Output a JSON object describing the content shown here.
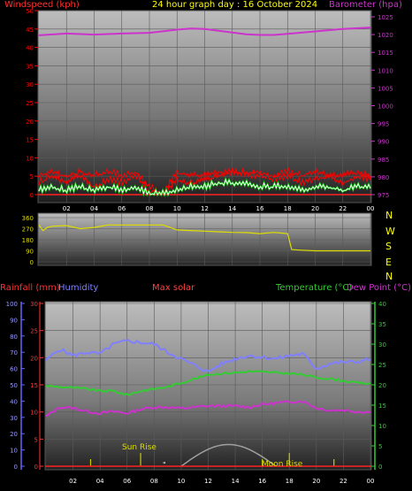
{
  "header": {
    "wind_label": "Windspeed (kph)",
    "title": "24 hour graph day : 16 October 2024",
    "baro_label": "Barometer (hpa)"
  },
  "bottom_header": {
    "rain_label": "Rainfall (mm)",
    "humidity_label": "Humidity",
    "solar_label": "Max solar",
    "temp_label": "Temperature (°C)",
    "dew_label": "Dew Point (°C)"
  },
  "annotations": {
    "sunrise": "Sun Rise",
    "moonrise": "Moon Rise",
    "dot": "\""
  },
  "compass": [
    "N",
    "W",
    "S",
    "E",
    "N"
  ],
  "colors": {
    "wind": "#ff0000",
    "gust": "#ff0000",
    "avg_wind": "#ffffff",
    "avg_wind_glow": "#00cc00",
    "barometer": "#cc33cc",
    "direction": "#dddd00",
    "humidity": "#8080ff",
    "temperature": "#33cc33",
    "dewpoint": "#cc33cc",
    "solar": "#a0a0a0",
    "rain_axis": "#ff3333",
    "hum_axis": "#6666ff",
    "temp_axis": "#33cc33",
    "title": "#ffff00",
    "events": "#cccc00"
  },
  "chart_data": [
    {
      "type": "line",
      "title": "24 hour graph day : 16 October 2024",
      "x_ticks": [
        "02",
        "04",
        "06",
        "08",
        "10",
        "12",
        "14",
        "16",
        "18",
        "20",
        "22",
        "00"
      ],
      "left_axis": {
        "label": "Windspeed (kph)",
        "ylim": [
          0,
          50
        ],
        "ticks": [
          0,
          5,
          10,
          15,
          20,
          25,
          30,
          35,
          40,
          45,
          50
        ]
      },
      "right_axis": {
        "label": "Barometer (hpa)",
        "ylim": [
          972.5,
          1027.5
        ],
        "ticks": [
          975,
          980,
          985,
          990,
          995,
          1000,
          1005,
          1010,
          1015,
          1020,
          1025
        ]
      },
      "series": [
        {
          "name": "Barometer (hpa)",
          "axis": "right",
          "x": [
            0,
            2,
            4,
            6,
            8,
            10,
            11,
            12,
            13,
            14,
            15,
            16,
            17,
            18,
            20,
            22,
            24
          ],
          "values": [
            1019.8,
            1020.3,
            1020.0,
            1020.3,
            1020.5,
            1021.4,
            1021.7,
            1021.6,
            1021.1,
            1020.6,
            1020.1,
            1019.9,
            1019.9,
            1020.2,
            1020.9,
            1021.6,
            1022.0
          ]
        },
        {
          "name": "Windspeed (kph)",
          "axis": "left",
          "x": [
            0,
            1,
            2,
            3,
            4,
            5,
            6,
            7,
            8,
            9,
            10,
            11,
            12,
            13,
            14,
            15,
            16,
            17,
            18,
            19,
            20,
            21,
            22,
            23,
            24
          ],
          "values": [
            3,
            5,
            3,
            5,
            2,
            4,
            3,
            5,
            1,
            0,
            4,
            3,
            4,
            5,
            6,
            5,
            5,
            4,
            5,
            3,
            4,
            5,
            3,
            5,
            4
          ]
        },
        {
          "name": "Gust (kph)",
          "axis": "left",
          "x": [
            0,
            1,
            2,
            3,
            4,
            5,
            6,
            7,
            8,
            9,
            10,
            11,
            12,
            13,
            14,
            15,
            16,
            17,
            18,
            19,
            20,
            21,
            22,
            23,
            24
          ],
          "values": [
            5,
            6,
            5,
            6,
            5,
            6,
            5,
            6,
            2,
            0,
            6,
            5,
            5,
            6,
            6,
            6,
            6,
            5,
            6,
            5,
            6,
            5,
            5,
            6,
            5
          ]
        },
        {
          "name": "Average wind (kph)",
          "axis": "left",
          "x": [
            0,
            1,
            2,
            3,
            4,
            5,
            6,
            7,
            8,
            9,
            10,
            11,
            12,
            13,
            14,
            15,
            16,
            17,
            18,
            19,
            20,
            21,
            22,
            23,
            24
          ],
          "values": [
            1,
            2,
            1,
            2,
            1,
            2,
            1,
            2,
            0,
            0,
            1,
            2,
            2,
            3,
            3,
            3,
            2,
            2,
            2,
            1,
            2,
            2,
            1,
            2,
            2
          ]
        }
      ]
    },
    {
      "type": "line",
      "x_ticks": [],
      "y_axis": {
        "ylim": [
          0,
          360
        ],
        "ticks": [
          0,
          90,
          180,
          270,
          360
        ]
      },
      "labels": [
        "N",
        "W",
        "S",
        "E",
        "N"
      ],
      "series": [
        {
          "name": "Wind direction (deg)",
          "x": [
            0,
            0.3,
            0.6,
            1,
            2,
            3,
            4,
            5,
            6,
            7,
            8,
            9,
            10,
            11,
            12,
            13,
            14,
            15,
            16,
            17,
            18,
            18.3,
            19,
            20,
            21,
            22,
            23,
            24
          ],
          "values": [
            300,
            255,
            280,
            290,
            295,
            270,
            280,
            300,
            300,
            300,
            300,
            300,
            260,
            255,
            250,
            245,
            240,
            238,
            230,
            240,
            230,
            100,
            95,
            90,
            90,
            90,
            90,
            90
          ]
        }
      ]
    },
    {
      "type": "line",
      "x_ticks": [
        "02",
        "04",
        "06",
        "08",
        "10",
        "12",
        "14",
        "16",
        "18",
        "20",
        "22",
        "00"
      ],
      "left_axis_rain": {
        "label": "Rainfall (mm)",
        "ylim": [
          0,
          30
        ],
        "ticks": [
          0,
          5,
          10,
          15,
          20,
          25,
          30
        ]
      },
      "left_axis_humidity": {
        "label": "Humidity",
        "ylim": [
          0,
          100
        ],
        "ticks": [
          0,
          10,
          20,
          30,
          40,
          50,
          60,
          70,
          80,
          90,
          100
        ]
      },
      "right_axis": {
        "label": "Temperature (°C)",
        "ylim": [
          0,
          40
        ],
        "ticks": [
          0,
          5,
          10,
          15,
          20,
          25,
          30,
          35,
          40
        ]
      },
      "series": [
        {
          "name": "Humidity",
          "axis": "humidity",
          "x": [
            0,
            1,
            2,
            3,
            4,
            5,
            6,
            7,
            8,
            9,
            10,
            11,
            12,
            13,
            14,
            15,
            16,
            17,
            18,
            19,
            20,
            21,
            22,
            23,
            24
          ],
          "values": [
            65,
            72,
            68,
            70,
            69,
            75,
            77,
            76,
            75,
            70,
            66,
            62,
            58,
            63,
            66,
            68,
            67,
            66,
            68,
            69,
            60,
            63,
            64,
            64,
            66
          ]
        },
        {
          "name": "Temperature (°C)",
          "axis": "temperature",
          "x": [
            0,
            1,
            2,
            3,
            4,
            5,
            6,
            7,
            8,
            9,
            10,
            11,
            12,
            13,
            14,
            15,
            16,
            17,
            18,
            19,
            20,
            21,
            22,
            23,
            24
          ],
          "values": [
            19.8,
            19.5,
            19.3,
            19.0,
            18.5,
            18.5,
            17.5,
            18.5,
            19.0,
            19.5,
            20.5,
            21.5,
            22.5,
            22.8,
            23.0,
            23.3,
            23.2,
            23.0,
            22.8,
            22.5,
            21.8,
            21.5,
            21.0,
            20.5,
            20.3
          ]
        },
        {
          "name": "Dew Point (°C)",
          "axis": "temperature",
          "x": [
            0,
            1,
            2,
            3,
            4,
            5,
            6,
            7,
            8,
            9,
            10,
            11,
            12,
            13,
            14,
            15,
            16,
            17,
            18,
            19,
            20,
            21,
            22,
            23,
            24
          ],
          "values": [
            12.2,
            14.5,
            14.3,
            13.5,
            13.0,
            13.5,
            13.0,
            14.0,
            14.5,
            14.5,
            14.2,
            14.5,
            14.8,
            14.8,
            14.8,
            14.5,
            15.2,
            15.5,
            15.8,
            16.0,
            14.3,
            13.7,
            13.8,
            13.4,
            13.3
          ]
        },
        {
          "name": "Max solar",
          "axis": "rain",
          "x": [
            10,
            11,
            12,
            13,
            14,
            15,
            16,
            17
          ],
          "values": [
            0,
            1.5,
            3,
            4,
            4,
            3,
            1.5,
            0
          ]
        }
      ],
      "events": [
        {
          "label": "Sun Rise",
          "x": 7
        },
        {
          "label": "Moon Rise",
          "x": 18
        }
      ]
    }
  ]
}
